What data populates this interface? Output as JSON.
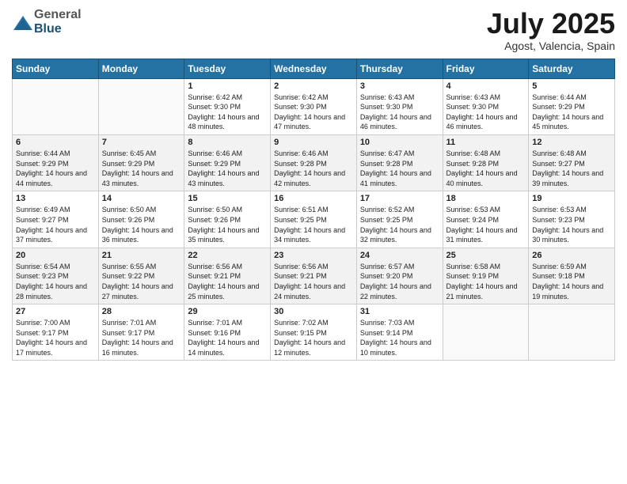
{
  "header": {
    "logo_general": "General",
    "logo_blue": "Blue",
    "month_title": "July 2025",
    "location": "Agost, Valencia, Spain"
  },
  "days_of_week": [
    "Sunday",
    "Monday",
    "Tuesday",
    "Wednesday",
    "Thursday",
    "Friday",
    "Saturday"
  ],
  "weeks": [
    {
      "shaded": false,
      "days": [
        {
          "num": "",
          "info": ""
        },
        {
          "num": "",
          "info": ""
        },
        {
          "num": "1",
          "info": "Sunrise: 6:42 AM\nSunset: 9:30 PM\nDaylight: 14 hours and 48 minutes."
        },
        {
          "num": "2",
          "info": "Sunrise: 6:42 AM\nSunset: 9:30 PM\nDaylight: 14 hours and 47 minutes."
        },
        {
          "num": "3",
          "info": "Sunrise: 6:43 AM\nSunset: 9:30 PM\nDaylight: 14 hours and 46 minutes."
        },
        {
          "num": "4",
          "info": "Sunrise: 6:43 AM\nSunset: 9:30 PM\nDaylight: 14 hours and 46 minutes."
        },
        {
          "num": "5",
          "info": "Sunrise: 6:44 AM\nSunset: 9:29 PM\nDaylight: 14 hours and 45 minutes."
        }
      ]
    },
    {
      "shaded": true,
      "days": [
        {
          "num": "6",
          "info": "Sunrise: 6:44 AM\nSunset: 9:29 PM\nDaylight: 14 hours and 44 minutes."
        },
        {
          "num": "7",
          "info": "Sunrise: 6:45 AM\nSunset: 9:29 PM\nDaylight: 14 hours and 43 minutes."
        },
        {
          "num": "8",
          "info": "Sunrise: 6:46 AM\nSunset: 9:29 PM\nDaylight: 14 hours and 43 minutes."
        },
        {
          "num": "9",
          "info": "Sunrise: 6:46 AM\nSunset: 9:28 PM\nDaylight: 14 hours and 42 minutes."
        },
        {
          "num": "10",
          "info": "Sunrise: 6:47 AM\nSunset: 9:28 PM\nDaylight: 14 hours and 41 minutes."
        },
        {
          "num": "11",
          "info": "Sunrise: 6:48 AM\nSunset: 9:28 PM\nDaylight: 14 hours and 40 minutes."
        },
        {
          "num": "12",
          "info": "Sunrise: 6:48 AM\nSunset: 9:27 PM\nDaylight: 14 hours and 39 minutes."
        }
      ]
    },
    {
      "shaded": false,
      "days": [
        {
          "num": "13",
          "info": "Sunrise: 6:49 AM\nSunset: 9:27 PM\nDaylight: 14 hours and 37 minutes."
        },
        {
          "num": "14",
          "info": "Sunrise: 6:50 AM\nSunset: 9:26 PM\nDaylight: 14 hours and 36 minutes."
        },
        {
          "num": "15",
          "info": "Sunrise: 6:50 AM\nSunset: 9:26 PM\nDaylight: 14 hours and 35 minutes."
        },
        {
          "num": "16",
          "info": "Sunrise: 6:51 AM\nSunset: 9:25 PM\nDaylight: 14 hours and 34 minutes."
        },
        {
          "num": "17",
          "info": "Sunrise: 6:52 AM\nSunset: 9:25 PM\nDaylight: 14 hours and 32 minutes."
        },
        {
          "num": "18",
          "info": "Sunrise: 6:53 AM\nSunset: 9:24 PM\nDaylight: 14 hours and 31 minutes."
        },
        {
          "num": "19",
          "info": "Sunrise: 6:53 AM\nSunset: 9:23 PM\nDaylight: 14 hours and 30 minutes."
        }
      ]
    },
    {
      "shaded": true,
      "days": [
        {
          "num": "20",
          "info": "Sunrise: 6:54 AM\nSunset: 9:23 PM\nDaylight: 14 hours and 28 minutes."
        },
        {
          "num": "21",
          "info": "Sunrise: 6:55 AM\nSunset: 9:22 PM\nDaylight: 14 hours and 27 minutes."
        },
        {
          "num": "22",
          "info": "Sunrise: 6:56 AM\nSunset: 9:21 PM\nDaylight: 14 hours and 25 minutes."
        },
        {
          "num": "23",
          "info": "Sunrise: 6:56 AM\nSunset: 9:21 PM\nDaylight: 14 hours and 24 minutes."
        },
        {
          "num": "24",
          "info": "Sunrise: 6:57 AM\nSunset: 9:20 PM\nDaylight: 14 hours and 22 minutes."
        },
        {
          "num": "25",
          "info": "Sunrise: 6:58 AM\nSunset: 9:19 PM\nDaylight: 14 hours and 21 minutes."
        },
        {
          "num": "26",
          "info": "Sunrise: 6:59 AM\nSunset: 9:18 PM\nDaylight: 14 hours and 19 minutes."
        }
      ]
    },
    {
      "shaded": false,
      "days": [
        {
          "num": "27",
          "info": "Sunrise: 7:00 AM\nSunset: 9:17 PM\nDaylight: 14 hours and 17 minutes."
        },
        {
          "num": "28",
          "info": "Sunrise: 7:01 AM\nSunset: 9:17 PM\nDaylight: 14 hours and 16 minutes."
        },
        {
          "num": "29",
          "info": "Sunrise: 7:01 AM\nSunset: 9:16 PM\nDaylight: 14 hours and 14 minutes."
        },
        {
          "num": "30",
          "info": "Sunrise: 7:02 AM\nSunset: 9:15 PM\nDaylight: 14 hours and 12 minutes."
        },
        {
          "num": "31",
          "info": "Sunrise: 7:03 AM\nSunset: 9:14 PM\nDaylight: 14 hours and 10 minutes."
        },
        {
          "num": "",
          "info": ""
        },
        {
          "num": "",
          "info": ""
        }
      ]
    }
  ]
}
